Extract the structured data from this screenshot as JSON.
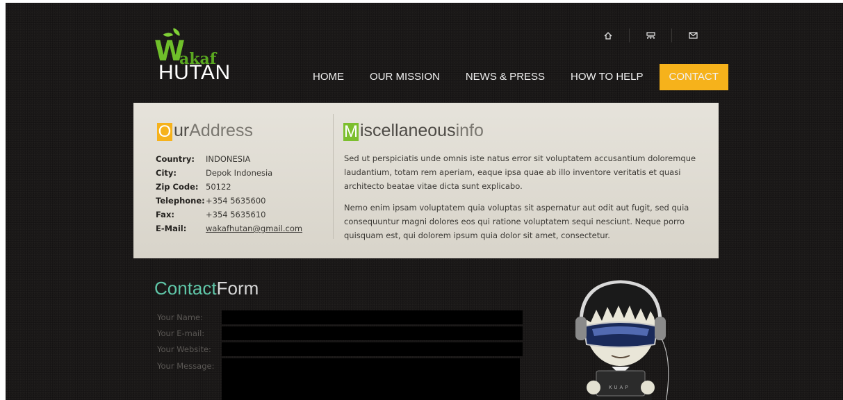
{
  "logo": {
    "top": "akaf",
    "bottom": "HUTAN",
    "initial": "W"
  },
  "top_icons": [
    "home-icon",
    "sitemap-icon",
    "mail-icon"
  ],
  "nav": {
    "items": [
      {
        "label": "HOME"
      },
      {
        "label": "OUR MISSION"
      },
      {
        "label": "NEWS & PRESS"
      },
      {
        "label": "HOW TO HELP"
      },
      {
        "label": "CONTACT",
        "active": true
      }
    ],
    "active_color": "#f6b21b"
  },
  "address": {
    "title_initial": "O",
    "title_bold": "ur",
    "title_rest": "Address",
    "rows": [
      {
        "label": "Country:",
        "value": "INDONESIA"
      },
      {
        "label": "City:",
        "value": "Depok Indonesia"
      },
      {
        "label": "Zip Code:",
        "value": "50122"
      },
      {
        "label": "Telephone:",
        "value": "+354 5635600"
      },
      {
        "label": "Fax:",
        "value": "+354 5635610"
      },
      {
        "label": "E-Mail:",
        "value": "wakafhutan@gmail.com"
      }
    ],
    "accent": "#f6b21b"
  },
  "misc": {
    "title_initial": "M",
    "title_bold": "iscellaneous",
    "title_rest": "info",
    "paragraphs": [
      "Sed ut perspiciatis unde omnis iste natus error sit voluptatem accusantium doloremque laudantium, totam rem aperiam, eaque ipsa quae ab illo inventore veritatis et quasi architecto beatae vitae dicta sunt explicabo.",
      "Nemo enim ipsam voluptatem quia voluptas sit aspernatur aut odit aut fugit, sed quia consequuntur magni dolores eos qui ratione voluptatem sequi nesciunt. Neque porro quisquam est, qui dolorem ipsum quia dolor sit amet, consectetur."
    ],
    "accent": "#7cbf2e"
  },
  "contact_form": {
    "title_bold": "Contact",
    "title_rest": "Form",
    "name_label": "Your Name:",
    "email_label": "Your E-mail:",
    "website_label": "Your Website:",
    "message_label": "Your Message:",
    "name_value": "",
    "email_value": "",
    "website_value": "",
    "message_value": ""
  },
  "mascot": {
    "laptop_text": "KUAP"
  }
}
